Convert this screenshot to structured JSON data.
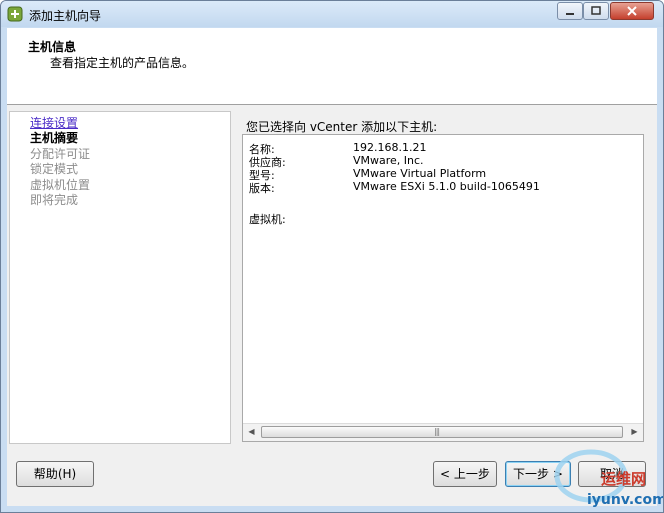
{
  "window": {
    "title": "添加主机向导"
  },
  "header": {
    "title": "主机信息",
    "subtitle": "查看指定主机的产品信息。"
  },
  "nav": {
    "items": [
      {
        "label": "连接设置",
        "state": "link"
      },
      {
        "label": "主机摘要",
        "state": "current"
      },
      {
        "label": "分配许可证",
        "state": "disabled"
      },
      {
        "label": "锁定模式",
        "state": "disabled"
      },
      {
        "label": "虚拟机位置",
        "state": "disabled"
      },
      {
        "label": "即将完成",
        "state": "disabled"
      }
    ]
  },
  "summary": {
    "heading": "您已选择向 vCenter 添加以下主机:",
    "rows": [
      {
        "label": "名称:",
        "value": "192.168.1.21"
      },
      {
        "label": "供应商:",
        "value": "VMware, Inc."
      },
      {
        "label": "型号:",
        "value": "VMware Virtual Platform"
      },
      {
        "label": "版本:",
        "value": "VMware ESXi 5.1.0 build-1065491"
      }
    ],
    "vm_label": "虚拟机:"
  },
  "buttons": {
    "help": {
      "text": "帮助",
      "key": "(H)"
    },
    "back": {
      "prefix": "< ",
      "text": "上一步"
    },
    "next": {
      "text": "下一步",
      "suffix": " >"
    },
    "cancel": "取消"
  },
  "watermark": {
    "text": "运维网",
    "url_text": "iyunv.com"
  },
  "colors": {
    "link": "#4a2cc7",
    "disabled": "#8c8c8c",
    "frame": "#c9ddf2",
    "close": "#c4402d"
  }
}
